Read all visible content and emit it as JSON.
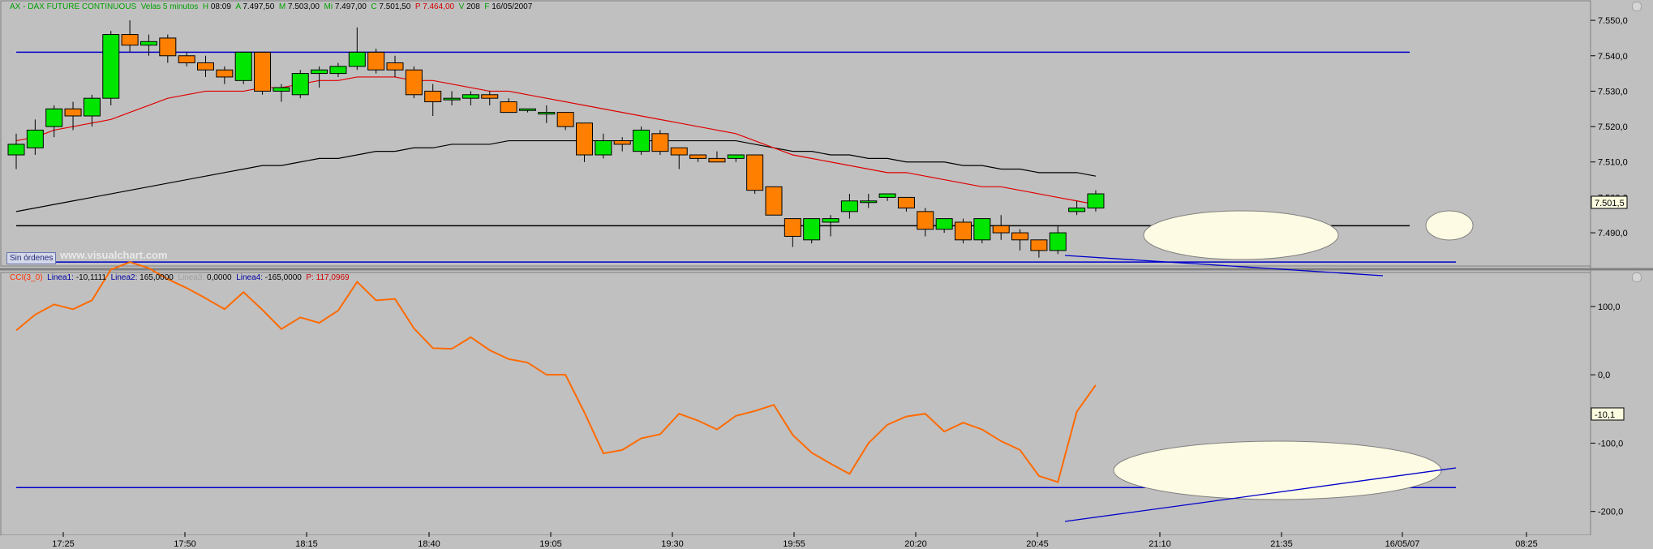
{
  "header": {
    "main": {
      "symbol": "AX - DAX FUTURE CONTINUOUS",
      "interval": "Velas 5 minutos",
      "h_label": "H",
      "h": "08:09",
      "a_label": "A",
      "a": "7.497,50",
      "m_label": "M",
      "m": "7.503,00",
      "mi_label": "Mi",
      "mi": "7.497,00",
      "c_label": "C",
      "c": "7.501,50",
      "p_label": "P",
      "p": "7.464,00",
      "v_label": "V",
      "v": "208",
      "f_label": "F",
      "f": "16/05/2007"
    },
    "sub": {
      "name": "CCI(3_0)",
      "l1_label": "Linea1:",
      "l1": "-10,1111",
      "l2_label": "Linea2:",
      "l2": "165,0000",
      "l3_label": "Linea3:",
      "l3": "0,0000",
      "l4_label": "Linea4:",
      "l4": "-165,0000",
      "p_label": "P:",
      "p": "117,0969"
    }
  },
  "sin_ordenes": "Sin órdenes",
  "watermark": "www.visualchart.com",
  "price_axis_labels": [
    "7.550,0",
    "7.540,0",
    "7.530,0",
    "7.520,0",
    "7.510,0",
    "7.500,0",
    "7.490,0"
  ],
  "current_price": "7.501,5",
  "cci_axis_labels": [
    "100,0",
    "0,0",
    "-100,0",
    "-200,0"
  ],
  "current_cci": "-10,1",
  "time_labels": [
    "17:25",
    "17:50",
    "18:15",
    "18:40",
    "19:05",
    "19:30",
    "19:55",
    "20:20",
    "20:45",
    "21:10",
    "21:35",
    "16/05/07",
    "08:25"
  ],
  "chart_data": [
    {
      "type": "candlestick",
      "ylim": [
        7482,
        7553
      ],
      "candles": [
        {
          "o": 7512,
          "h": 7518,
          "l": 7508,
          "c": 7515
        },
        {
          "o": 7514,
          "h": 7522,
          "l": 7512,
          "c": 7519
        },
        {
          "o": 7520,
          "h": 7526,
          "l": 7517,
          "c": 7525
        },
        {
          "o": 7525,
          "h": 7527,
          "l": 7519,
          "c": 7523
        },
        {
          "o": 7523,
          "h": 7529,
          "l": 7520,
          "c": 7528
        },
        {
          "o": 7528,
          "h": 7547,
          "l": 7526,
          "c": 7546
        },
        {
          "o": 7546,
          "h": 7550,
          "l": 7541,
          "c": 7543
        },
        {
          "o": 7543,
          "h": 7546,
          "l": 7540,
          "c": 7544
        },
        {
          "o": 7545,
          "h": 7546,
          "l": 7538,
          "c": 7540
        },
        {
          "o": 7540,
          "h": 7541,
          "l": 7537,
          "c": 7538
        },
        {
          "o": 7538,
          "h": 7540,
          "l": 7534,
          "c": 7536
        },
        {
          "o": 7536,
          "h": 7537,
          "l": 7532,
          "c": 7534
        },
        {
          "o": 7533,
          "h": 7541,
          "l": 7532,
          "c": 7541
        },
        {
          "o": 7541,
          "h": 7541,
          "l": 7529,
          "c": 7530
        },
        {
          "o": 7530,
          "h": 7532,
          "l": 7527,
          "c": 7531
        },
        {
          "o": 7529,
          "h": 7536,
          "l": 7528,
          "c": 7535
        },
        {
          "o": 7535,
          "h": 7537,
          "l": 7531,
          "c": 7536
        },
        {
          "o": 7535,
          "h": 7538,
          "l": 7534,
          "c": 7537
        },
        {
          "o": 7537,
          "h": 7548,
          "l": 7536,
          "c": 7541
        },
        {
          "o": 7541,
          "h": 7542,
          "l": 7535,
          "c": 7536
        },
        {
          "o": 7538,
          "h": 7540,
          "l": 7534,
          "c": 7536
        },
        {
          "o": 7536,
          "h": 7537,
          "l": 7528,
          "c": 7529
        },
        {
          "o": 7530,
          "h": 7532,
          "l": 7523,
          "c": 7527
        },
        {
          "o": 7528,
          "h": 7530,
          "l": 7526,
          "c": 7528
        },
        {
          "o": 7528,
          "h": 7530,
          "l": 7526,
          "c": 7529
        },
        {
          "o": 7529,
          "h": 7530,
          "l": 7526,
          "c": 7528
        },
        {
          "o": 7527,
          "h": 7528,
          "l": 7524,
          "c": 7524
        },
        {
          "o": 7525,
          "h": 7525,
          "l": 7524,
          "c": 7525
        },
        {
          "o": 7524,
          "h": 7526,
          "l": 7521,
          "c": 7524
        },
        {
          "o": 7524,
          "h": 7524,
          "l": 7519,
          "c": 7520
        },
        {
          "o": 7521,
          "h": 7521,
          "l": 7510,
          "c": 7512
        },
        {
          "o": 7512,
          "h": 7518,
          "l": 7511,
          "c": 7516
        },
        {
          "o": 7516,
          "h": 7517,
          "l": 7513,
          "c": 7515
        },
        {
          "o": 7513,
          "h": 7520,
          "l": 7512,
          "c": 7519
        },
        {
          "o": 7518,
          "h": 7519,
          "l": 7512,
          "c": 7513
        },
        {
          "o": 7514,
          "h": 7514,
          "l": 7508,
          "c": 7512
        },
        {
          "o": 7512,
          "h": 7512,
          "l": 7510,
          "c": 7511
        },
        {
          "o": 7511,
          "h": 7513,
          "l": 7510,
          "c": 7510
        },
        {
          "o": 7511,
          "h": 7512,
          "l": 7510,
          "c": 7512
        },
        {
          "o": 7512,
          "h": 7512,
          "l": 7501,
          "c": 7502
        },
        {
          "o": 7503,
          "h": 7503,
          "l": 7495,
          "c": 7495
        },
        {
          "o": 7494,
          "h": 7494,
          "l": 7486,
          "c": 7489
        },
        {
          "o": 7488,
          "h": 7494,
          "l": 7487,
          "c": 7494
        },
        {
          "o": 7493,
          "h": 7495,
          "l": 7489,
          "c": 7494
        },
        {
          "o": 7496,
          "h": 7501,
          "l": 7494,
          "c": 7499
        },
        {
          "o": 7499,
          "h": 7501,
          "l": 7497,
          "c": 7499
        },
        {
          "o": 7500,
          "h": 7501,
          "l": 7499,
          "c": 7501
        },
        {
          "o": 7500,
          "h": 7500,
          "l": 7496,
          "c": 7497
        },
        {
          "o": 7496,
          "h": 7497,
          "l": 7489,
          "c": 7491
        },
        {
          "o": 7491,
          "h": 7494,
          "l": 7490,
          "c": 7494
        },
        {
          "o": 7493,
          "h": 7494,
          "l": 7487,
          "c": 7488
        },
        {
          "o": 7488,
          "h": 7494,
          "l": 7487,
          "c": 7494
        },
        {
          "o": 7492,
          "h": 7495,
          "l": 7488,
          "c": 7490
        },
        {
          "o": 7490,
          "h": 7491,
          "l": 7485,
          "c": 7488
        },
        {
          "o": 7488,
          "h": 7488,
          "l": 7483,
          "c": 7485
        },
        {
          "o": 7485,
          "h": 7492,
          "l": 7484,
          "c": 7490
        },
        {
          "o": 7496,
          "h": 7499,
          "l": 7495,
          "c": 7497
        },
        {
          "o": 7497,
          "h": 7502,
          "l": 7496,
          "c": 7501
        }
      ],
      "moving_average_red": [
        7516,
        7517,
        7519,
        7520,
        7521,
        7522,
        7524,
        7526,
        7528,
        7529,
        7530,
        7530,
        7530,
        7531,
        7531,
        7532,
        7533,
        7533,
        7534,
        7534,
        7534,
        7533,
        7533,
        7532,
        7531,
        7530,
        7530,
        7529,
        7528,
        7527,
        7526,
        7525,
        7524,
        7523,
        7522,
        7521,
        7520,
        7519,
        7518,
        7516,
        7514,
        7512,
        7511,
        7510,
        7509,
        7508,
        7507,
        7507,
        7506,
        7505,
        7504,
        7503,
        7503,
        7502,
        7501,
        7500,
        7499,
        7498
      ],
      "moving_average_black": [
        7496,
        7497,
        7498,
        7499,
        7500,
        7501,
        7502,
        7503,
        7504,
        7505,
        7506,
        7507,
        7508,
        7509,
        7509,
        7510,
        7511,
        7511,
        7512,
        7513,
        7513,
        7514,
        7514,
        7515,
        7515,
        7515,
        7516,
        7516,
        7516,
        7516,
        7516,
        7516,
        7516,
        7516,
        7516,
        7516,
        7516,
        7516,
        7516,
        7515,
        7514,
        7513,
        7513,
        7512,
        7512,
        7511,
        7511,
        7510,
        7510,
        7510,
        7509,
        7509,
        7508,
        7508,
        7507,
        7507,
        7507,
        7506
      ],
      "horizontal_lines": [
        7541,
        7492
      ]
    },
    {
      "type": "line",
      "name": "CCI(3_0)",
      "ylim": [
        -230,
        145
      ],
      "values": [
        65,
        88,
        103,
        96,
        109,
        154,
        165,
        156,
        140,
        127,
        112,
        96,
        121,
        95,
        67,
        84,
        76,
        94,
        136,
        109,
        111,
        68,
        39,
        38,
        55,
        36,
        23,
        18,
        0,
        0,
        -55,
        -115,
        -110,
        -93,
        -87,
        -57,
        -67,
        -80,
        -60,
        -53,
        -44,
        -88,
        -114,
        -130,
        -145,
        -100,
        -73,
        -61,
        -57,
        -83,
        -70,
        -80,
        -97,
        -110,
        -148,
        -157,
        -54,
        -15
      ],
      "horizontal_lines": [
        165,
        -165
      ],
      "ylabel": ""
    }
  ],
  "colors": {
    "bull": "#00e600",
    "bear": "#ff8000",
    "red_ma": "#e00000",
    "black_ma": "#000000",
    "blue": "#0000cc",
    "cci": "#ff6a00",
    "highlight": "#fdfbe3",
    "header_green": "#00b000"
  }
}
